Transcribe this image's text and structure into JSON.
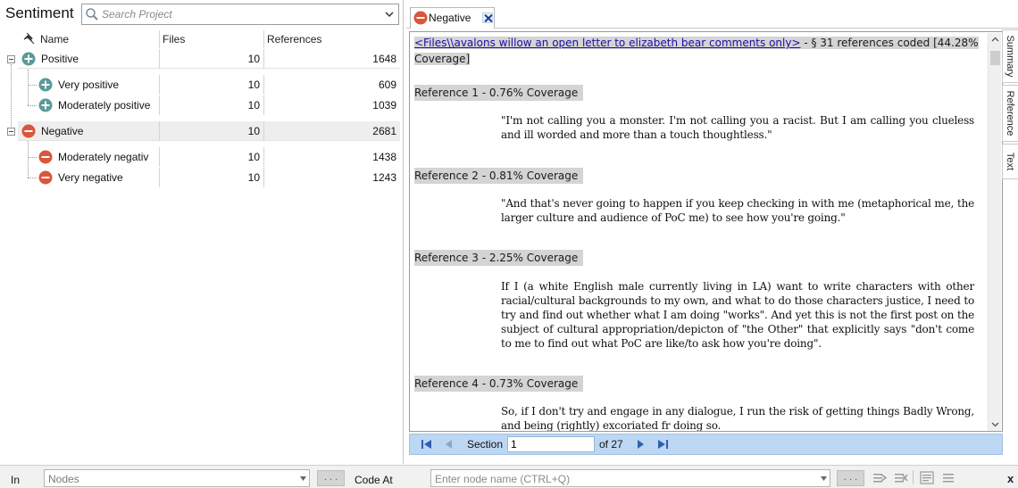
{
  "left": {
    "title": "Sentiment",
    "search_placeholder": "Search Project",
    "columns": {
      "name": "Name",
      "files": "Files",
      "refs": "References"
    },
    "rows": [
      {
        "name": "Positive",
        "files": "10",
        "refs": "1648",
        "type": "positive",
        "level": 0
      },
      {
        "name": "Very positive",
        "files": "10",
        "refs": "609",
        "type": "positive",
        "level": 1
      },
      {
        "name": "Moderately positive",
        "files": "10",
        "refs": "1039",
        "type": "positive",
        "level": 1
      },
      {
        "name": "Negative",
        "files": "10",
        "refs": "2681",
        "type": "negative",
        "level": 0
      },
      {
        "name": "Moderately negativ",
        "files": "10",
        "refs": "1438",
        "type": "negative",
        "level": 1
      },
      {
        "name": "Very negative",
        "files": "10",
        "refs": "1243",
        "type": "negative",
        "level": 1
      }
    ]
  },
  "tab": {
    "label": "Negative"
  },
  "content": {
    "source_link": "<Files\\\\avalons willow an open letter to elizabeth bear comments only>",
    "summary_suffix": " - § 31 references coded  [44.28%",
    "summary_line2": "Coverage]",
    "references": [
      {
        "title": "Reference 1 - 0.76% Coverage",
        "text": "\"I'm not calling you a monster. I'm not calling you a racist. But I am calling you clueless and ill worded and more than a touch thoughtless.\""
      },
      {
        "title": "Reference 2 - 0.81% Coverage",
        "text": "\"And that's never going to happen if you keep checking in with me (metaphorical me, the larger culture and audience of PoC me) to see how you're going.\""
      },
      {
        "title": "Reference 3 - 2.25% Coverage",
        "text": "If I (a white English male currently living in LA) want to write characters with other racial/cultural backgrounds to my own, and what to do those characters justice, I need to try and find out whether what I am doing \"works\". And yet this is not the first post on the subject of cultural appropriation/depicton of \"the Other\" that explicitly says \"don't come to me to find out what PoC are like/to ask how you're doing\"."
      },
      {
        "title": "Reference 4 - 0.73% Coverage",
        "text": "So, if I don't try and engage in any dialogue, I run the risk of getting things Badly Wrong, and being (rightly) excoriated fr doing so."
      }
    ]
  },
  "side_tabs": [
    "Summary",
    "Reference",
    "Text"
  ],
  "nav": {
    "section_label": "Section",
    "section_value": "1",
    "of_label": "of 27"
  },
  "bottom": {
    "in_label": "In",
    "nodes_placeholder": "Nodes",
    "dots_label": ". . .",
    "code_at_label": "Code At",
    "code_input_placeholder": "Enter node name (CTRL+Q)",
    "close_label": "x"
  },
  "colors": {
    "positive": "#5a9a9a",
    "negative": "#d9573a",
    "nav_bg": "#bcd7f4",
    "link": "#1a0dab"
  }
}
